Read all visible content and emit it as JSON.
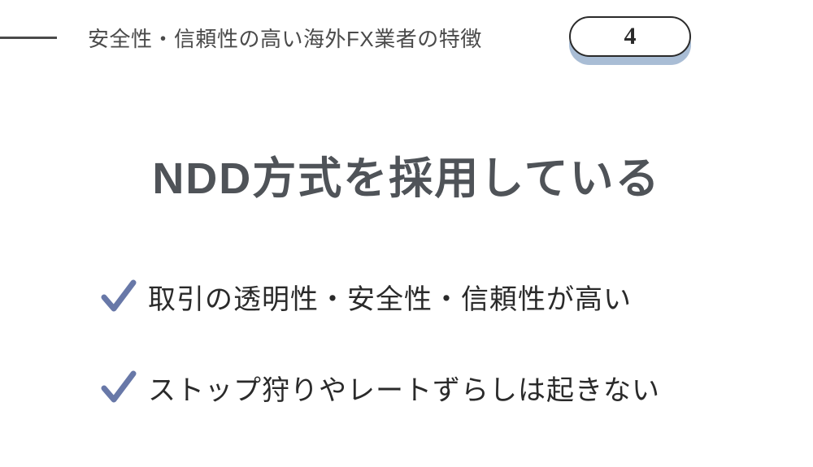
{
  "header": {
    "title": "安全性・信頼性の高い海外FX業者の特徴",
    "badge_number": "4"
  },
  "main": {
    "title": "NDD方式を採用している"
  },
  "bullets": [
    {
      "text": "取引の透明性・安全性・信頼性が高い"
    },
    {
      "text": "ストップ狩りやレートずらしは起きない"
    }
  ],
  "colors": {
    "accent": "#6878a8",
    "badge_shadow": "#a9bdd5",
    "text_dark": "#4a4a4a",
    "text_body": "#2a2a2a"
  }
}
